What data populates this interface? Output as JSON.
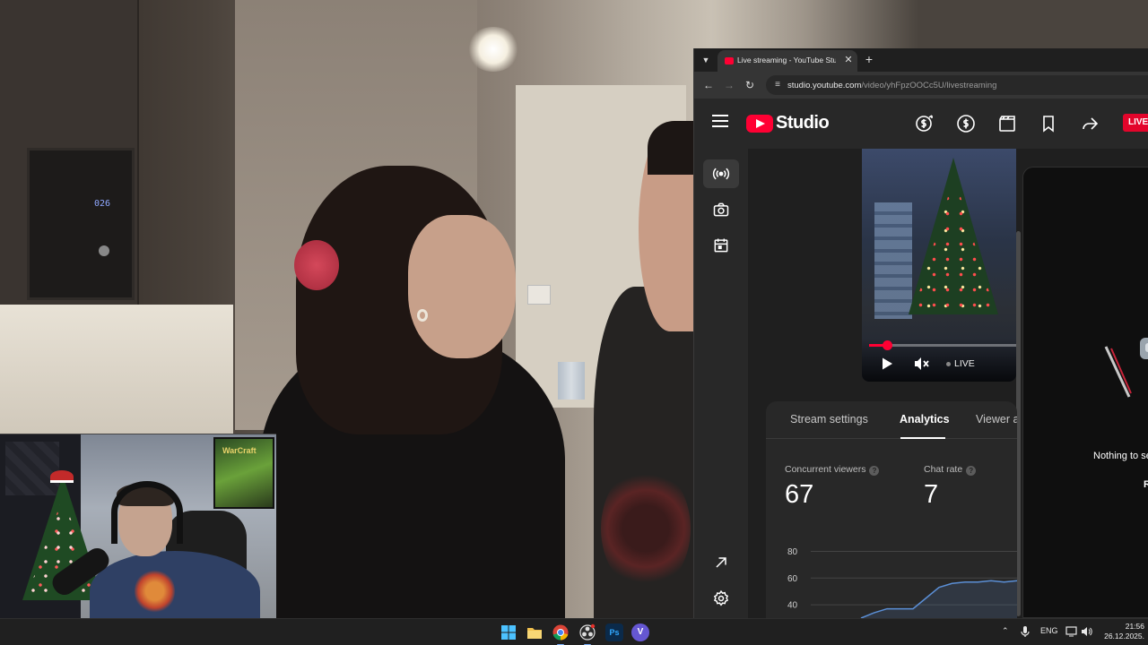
{
  "scene": {
    "microwave_display": "026",
    "poster_text": "WarCraft"
  },
  "browser": {
    "tab_title": "Live streaming - YouTube Studi",
    "url_host": "studio.youtube.com",
    "url_path": "/video/yhFpzOOCc5U/livestreaming"
  },
  "studio": {
    "wordmark": "Studio",
    "live_badge": "LIVE",
    "header_icons": [
      "monetization-icon",
      "earnings-icon",
      "clapperboard-icon",
      "bookmark-icon",
      "share-icon"
    ],
    "side_nav": [
      "live-stream-icon",
      "camera-icon",
      "calendar-icon"
    ],
    "side_nav_bottom": [
      "external-link-icon",
      "settings-icon"
    ],
    "player": {
      "progress_fraction": 0.12,
      "live_label": "LIVE"
    },
    "tabs": [
      "Stream settings",
      "Analytics",
      "Viewer a"
    ],
    "active_tab": "Analytics",
    "metrics": [
      {
        "label": "Concurrent viewers",
        "value": "67"
      },
      {
        "label": "Chat rate",
        "value": "7"
      }
    ],
    "right_panel": {
      "empty_text": "Nothing to se",
      "sub_text": "R"
    },
    "accent_color": "#ff0033"
  },
  "chart_data": {
    "type": "line",
    "y_ticks": [
      "80",
      "60",
      "40"
    ],
    "ylim": [
      30,
      85
    ],
    "series": [
      {
        "values": [
          30,
          34,
          37,
          37,
          37,
          45,
          53,
          56,
          57,
          57,
          58,
          57,
          58
        ]
      }
    ],
    "grid": true,
    "color": "#5b8fd6"
  },
  "taskbar": {
    "apps": [
      "windows-start-icon",
      "file-explorer-icon",
      "chrome-icon",
      "obs-icon",
      "photoshop-icon",
      "viber-icon"
    ],
    "photoshop_label": "Ps",
    "viber_label": "V",
    "language": "ENG",
    "time": "21:56",
    "date": "26.12.2025."
  }
}
